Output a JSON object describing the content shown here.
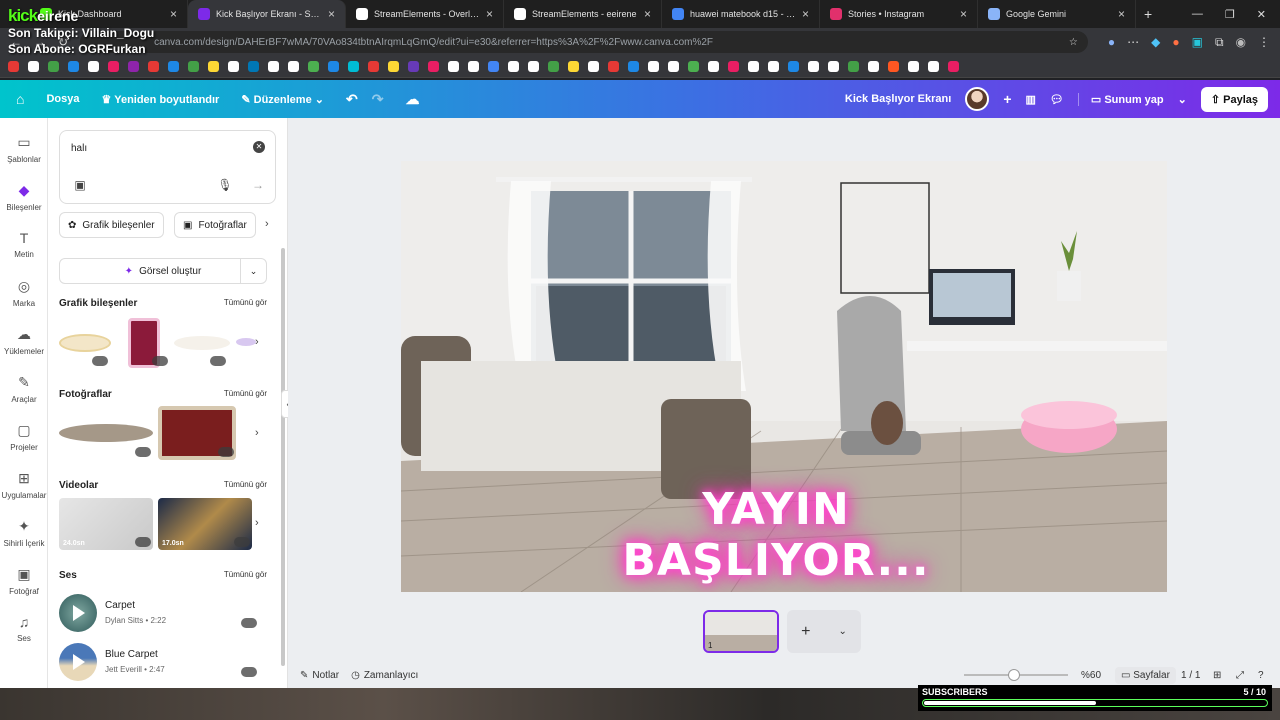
{
  "browser": {
    "tabs": [
      {
        "title": "Kick Dashboard",
        "color": "#53fc18"
      },
      {
        "title": "Kick Başlıyor Ekranı - Sunum",
        "color": "#7d2ae8",
        "active": true
      },
      {
        "title": "StreamElements - Overlays",
        "color": "#ffffff"
      },
      {
        "title": "StreamElements - eeirene",
        "color": "#ffffff"
      },
      {
        "title": "huawei matebook d15 - Googl",
        "color": "#4285f4"
      },
      {
        "title": "Stories • Instagram",
        "color": "#e1306c"
      },
      {
        "title": "Google Gemini",
        "color": "#8ab4f8"
      }
    ],
    "url": "canva.com/design/DAHErBF7wMA/70VAo834tbtnAIrqmLqGmQ/edit?ui=e30&referrer=https%3A%2F%2Fwww.canva.com%2F"
  },
  "stream_overlay": {
    "brand": "kick",
    "channel": "eirene",
    "last_follower": "Son Takipçi: Villain_Dogu",
    "last_sub": "Son Abone: OGRFurkan"
  },
  "canva_bar": {
    "file": "Dosya",
    "resize": "Yeniden boyutlandır",
    "editing": "Düzenleme",
    "design_title": "Kick Başlıyor Ekranı",
    "present": "Sunum yap",
    "share": "Paylaş"
  },
  "rail": [
    {
      "label": "Şablonlar",
      "icon": "▭"
    },
    {
      "label": "Bileşenler",
      "icon": "◆",
      "selected": true
    },
    {
      "label": "Metin",
      "icon": "T"
    },
    {
      "label": "Marka",
      "icon": "◎"
    },
    {
      "label": "Yüklemeler",
      "icon": "☁"
    },
    {
      "label": "Araçlar",
      "icon": "✎"
    },
    {
      "label": "Projeler",
      "icon": "▢"
    },
    {
      "label": "Uygulamalar",
      "icon": "⊞"
    },
    {
      "label": "Sihirli İçerik",
      "icon": "✦"
    },
    {
      "label": "Fotoğraf",
      "icon": "▣"
    },
    {
      "label": "Ses",
      "icon": "♫"
    }
  ],
  "panel": {
    "search_value": "halı",
    "chip_graphics": "Grafik bileşenler",
    "chip_photos": "Fotoğraflar",
    "generate": "Görsel oluştur",
    "see_all": "Tümünü gör",
    "sections": {
      "graphics": "Grafik bileşenler",
      "photos": "Fotoğraflar",
      "videos": "Videolar",
      "audio": "Ses"
    },
    "videos": [
      "24.0sn",
      "17.0sn"
    ],
    "tracks": [
      {
        "name": "Carpet",
        "meta": "Dylan Sitts • 2:22"
      },
      {
        "name": "Blue Carpet",
        "meta": "Jett Everill • 2:47"
      }
    ]
  },
  "slide": {
    "headline": "YAYIN BAŞLIYOR...",
    "page_number": "1"
  },
  "footer": {
    "notes": "Notlar",
    "timer": "Zamanlayıcı",
    "zoom": "%60",
    "pages": "Sayfalar",
    "page_count": "1 / 1"
  },
  "subs_widget": {
    "label": "SUBSCRIBERS",
    "count": "5 / 10",
    "progress": 0.5
  }
}
